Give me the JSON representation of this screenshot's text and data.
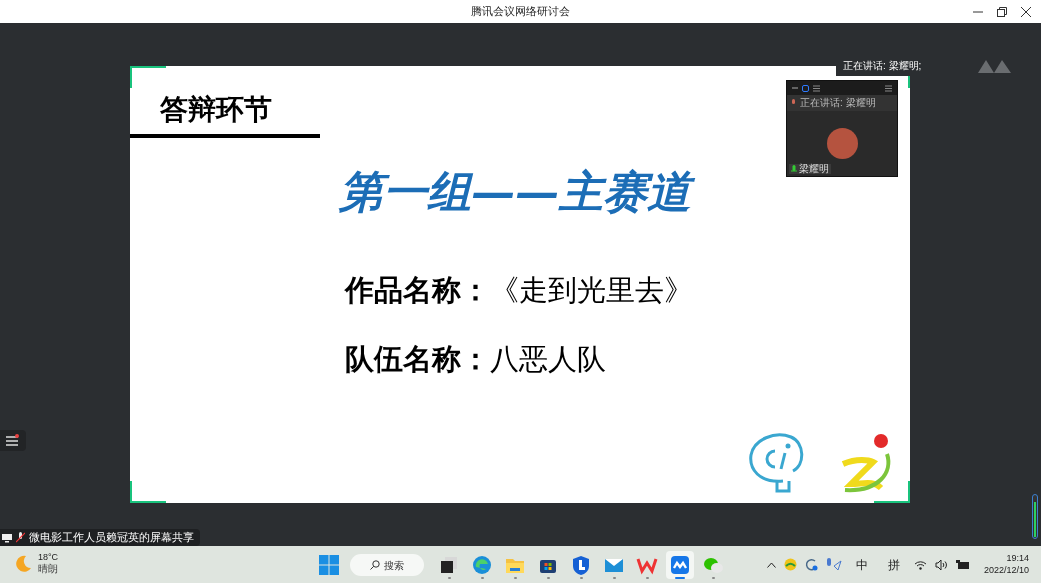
{
  "window": {
    "title": "腾讯会议网络研讨会"
  },
  "speaking": {
    "label": "正在讲话: 梁耀明;"
  },
  "mini_video": {
    "speaking_label": "正在讲话: 梁耀明",
    "name": "梁耀明"
  },
  "slide": {
    "heading": "答辩环节",
    "title": "第一组——主赛道",
    "lines": [
      {
        "label": "作品名称：",
        "value": "《走到光里去》"
      },
      {
        "label": "队伍名称：",
        "value": "八恶人队"
      }
    ]
  },
  "share_bar": {
    "text": "微电影工作人员赖冠英的屏幕共享"
  },
  "taskbar": {
    "weather": {
      "temperature": "18°C",
      "condition": "晴朗"
    },
    "search": "搜索",
    "apps": [
      {
        "kind": "taskview",
        "selected": false
      },
      {
        "kind": "edge",
        "selected": false
      },
      {
        "kind": "folder",
        "selected": false
      },
      {
        "kind": "store",
        "selected": false
      },
      {
        "kind": "lapp",
        "selected": false
      },
      {
        "kind": "mail",
        "selected": false
      },
      {
        "kind": "wps",
        "selected": false
      },
      {
        "kind": "meeting",
        "selected": true
      },
      {
        "kind": "chat",
        "selected": false
      }
    ],
    "ime": [
      "中",
      "拼"
    ],
    "time": "19:14",
    "date": "2022/12/10"
  }
}
